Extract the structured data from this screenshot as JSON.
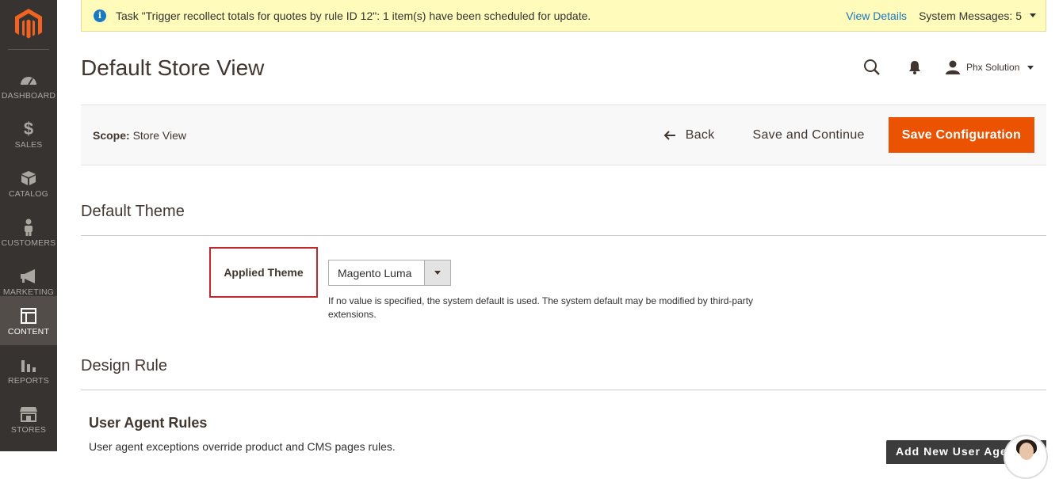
{
  "sidebar": {
    "logo": "magento-logo",
    "items": [
      {
        "label": "DASHBOARD",
        "icon": "dashboard-gauge-icon"
      },
      {
        "label": "SALES",
        "icon": "dollar-icon"
      },
      {
        "label": "CATALOG",
        "icon": "box-icon"
      },
      {
        "label": "CUSTOMERS",
        "icon": "person-icon"
      },
      {
        "label": "MARKETING",
        "icon": "megaphone-icon"
      },
      {
        "label": "CONTENT",
        "icon": "layout-icon",
        "active": true
      },
      {
        "label": "REPORTS",
        "icon": "bar-chart-icon"
      },
      {
        "label": "STORES",
        "icon": "storefront-icon"
      }
    ]
  },
  "message_bar": {
    "text": "Task \"Trigger recollect totals for quotes by rule ID 12\": 1 item(s) have been scheduled for update.",
    "view_details": "View Details",
    "system_messages": "System Messages: 5"
  },
  "header": {
    "title": "Default Store View",
    "user_name": "Phx Solution"
  },
  "action_bar": {
    "scope_label": "Scope:",
    "scope_value": "Store View",
    "back": "Back",
    "save_continue": "Save and Continue",
    "save_config": "Save Configuration"
  },
  "default_theme": {
    "section_title": "Default Theme",
    "field_label": "Applied Theme",
    "selected_value": "Magento Luma",
    "note": "If no value is specified, the system default is used. The system default may be modified by third-party extensions."
  },
  "design_rule": {
    "section_title": "Design Rule",
    "subsection_title": "User Agent Rules",
    "subsection_note": "User agent exceptions override product and CMS pages rules."
  },
  "chat_widget": {
    "text": "Add New User Agent"
  },
  "colors": {
    "accent": "#eb5202",
    "sidebar": "#373330",
    "message_bg": "#fffbbb",
    "link": "#1979c3",
    "highlight_border": "#c3262b"
  }
}
